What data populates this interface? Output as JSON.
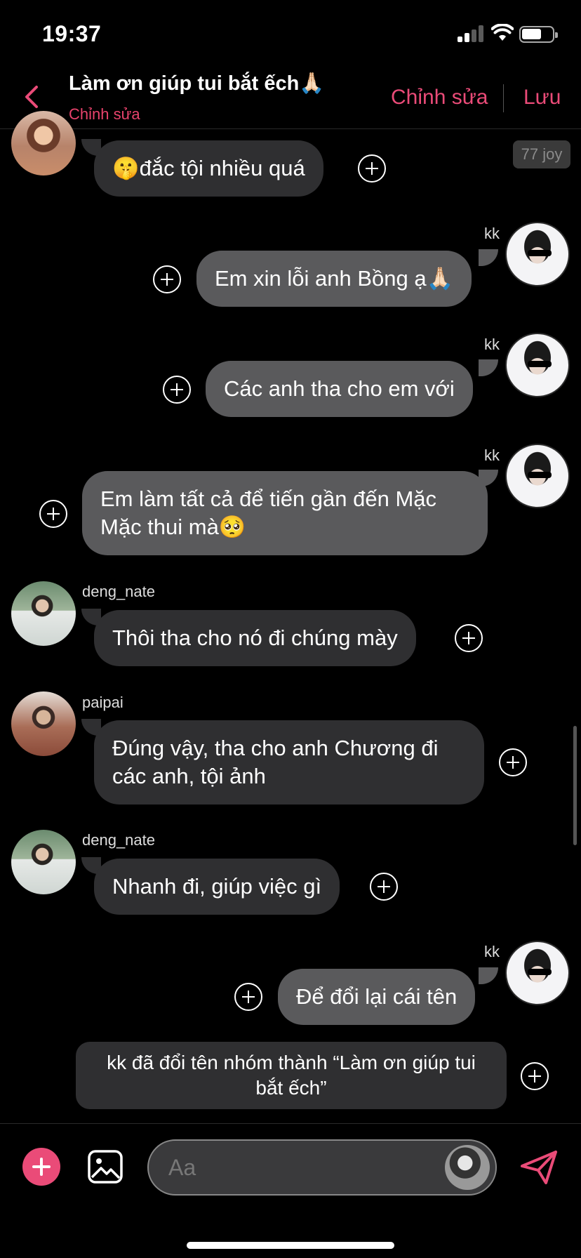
{
  "status_bar": {
    "time": "19:37"
  },
  "header": {
    "title": "Làm ơn giúp tui bắt ếch🙏🏻",
    "subtitle": "Chỉnh sửa",
    "edit_label": "Chỉnh sửa",
    "save_label": "Lưu"
  },
  "badge": "77 joy",
  "messages": [
    {
      "sender": "",
      "text": "🤫đắc tội nhiều quá"
    },
    {
      "sender": "kk",
      "text": "Em xin lỗi anh Bồng ạ🙏🏻"
    },
    {
      "sender": "kk",
      "text": "Các anh tha cho em với"
    },
    {
      "sender": "kk",
      "text": "Em làm tất cả để tiến gần đến Mặc Mặc thui mà🥺"
    },
    {
      "sender": "deng_nate",
      "text": "Thôi tha cho nó đi chúng mày"
    },
    {
      "sender": "paipai",
      "text": "Đúng vậy, tha cho anh Chương đi các anh, tội ảnh"
    },
    {
      "sender": "deng_nate",
      "text": "Nhanh đi, giúp việc gì"
    },
    {
      "sender": "kk",
      "text": "Để đổi lại cái tên"
    }
  ],
  "system_message": "kk đã đổi tên nhóm thành “Làm ơn giúp tui bắt ếch”",
  "composer": {
    "placeholder": "Aa"
  },
  "icons": {
    "back": "chevron-left-icon",
    "add": "plus-icon",
    "image": "image-icon",
    "send": "send-icon",
    "react": "plus-circle-icon"
  },
  "colors": {
    "accent": "#ea4b78",
    "incoming_bubble": "#2f2f31",
    "outgoing_bubble": "#5a5a5c",
    "background": "#000000"
  }
}
